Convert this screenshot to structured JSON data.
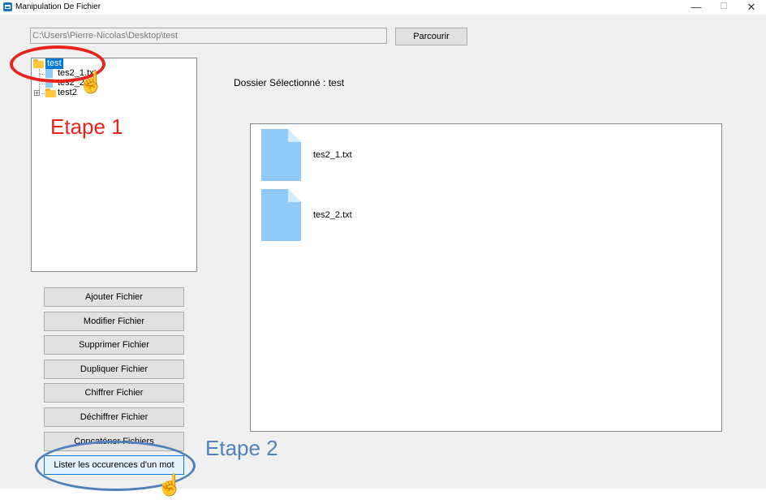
{
  "window": {
    "title": "Manipulation De Fichier",
    "controls": {
      "minimize": "—",
      "maximize": "☐",
      "close": "✕"
    }
  },
  "path_field": {
    "value": "C:\\Users\\Pierre-Nicolas\\Desktop\\test"
  },
  "browse_button": {
    "label": "Parcourir"
  },
  "tree": {
    "root": {
      "label": "test",
      "selected": true,
      "icon": "folder-icon"
    },
    "children": [
      {
        "label": "tes2_1.txt",
        "icon": "file-icon"
      },
      {
        "label": "tes2_2.txt",
        "icon": "file-icon"
      },
      {
        "label": "test2",
        "icon": "folder-icon",
        "expander": "+"
      }
    ]
  },
  "selected_folder_label": "Dossier Sélectionné : test",
  "files_panel": {
    "files": [
      {
        "name": "tes2_1.txt",
        "icon": "file-icon"
      },
      {
        "name": "tes2_2.txt",
        "icon": "file-icon"
      }
    ]
  },
  "actions": [
    {
      "label": "Ajouter Fichier"
    },
    {
      "label": "Modifier Fichier"
    },
    {
      "label": "Supprimer Fichier"
    },
    {
      "label": "Dupliquer Fichier"
    },
    {
      "label": "Chiffrer Fichier"
    },
    {
      "label": "Déchiffrer Fichier"
    },
    {
      "label": "Concaténer Fichiers"
    },
    {
      "label": "Lister les occurences d'un mot"
    }
  ],
  "annotations": {
    "step1": {
      "text": "Etape 1",
      "color": "#e8231c"
    },
    "step2": {
      "text": "Etape 2",
      "color": "#4f81bd"
    }
  },
  "colors": {
    "selection": "#0078d7",
    "folder": "#ffc83d",
    "file": "#90caf9",
    "active_button_border": "#0078d7"
  }
}
